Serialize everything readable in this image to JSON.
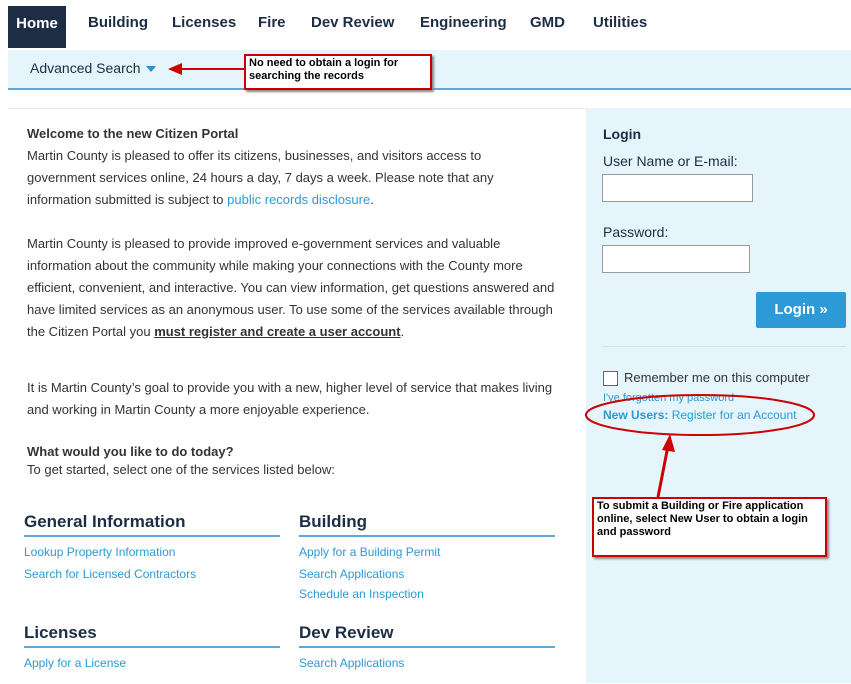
{
  "nav": {
    "tabs": [
      "Home",
      "Building",
      "Licenses",
      "Fire",
      "Dev Review",
      "Engineering",
      "GMD",
      "Utilities"
    ],
    "advanced_search": "Advanced Search"
  },
  "callouts": {
    "top": "No need to obtain a login for searching the records",
    "bottom": "To submit a Building or Fire application online, select New User to obtain a login and password"
  },
  "welcome": {
    "title": "Welcome to the new Citizen Portal",
    "p1_a": "Martin County is pleased to offer its citizens, businesses, and visitors access to government services online, 24 hours a day, 7 days a week.  Please note that any information submitted is subject to ",
    "p1_link": "public records disclosure",
    "p1_end": ".",
    "p2_a": "Martin County is pleased to provide improved e-government services and valuable information about the community while making your connections with the County more efficient, convenient, and interactive. You can view information, get questions answered and have limited services as an anonymous user.  To use some of the services available through the Citizen Portal you ",
    "p2_bold": "must register and create a user account",
    "p2_end": ".",
    "p3": "It is Martin County’s goal to provide you with a new, higher level of service that makes living and working in Martin County a more enjoyable experience.",
    "todo_title": "What would you like to do today?",
    "todo_sub": "To get started, select one of the services listed below:"
  },
  "sections": {
    "general": {
      "title": "General Information",
      "links": [
        "Lookup Property Information",
        "Search for Licensed Contractors"
      ]
    },
    "building": {
      "title": "Building",
      "links": [
        "Apply for a Building Permit",
        "Search Applications",
        "Schedule an Inspection"
      ]
    },
    "licenses": {
      "title": "Licenses",
      "links": [
        "Apply for a License"
      ]
    },
    "devreview": {
      "title": "Dev Review",
      "links": [
        "Search Applications"
      ]
    }
  },
  "login": {
    "title": "Login",
    "user_label": "User Name or E-mail:",
    "user_value": "",
    "pass_label": "Password:",
    "pass_value": "",
    "button": "Login »",
    "remember": "Remember me on this computer",
    "forgot": "I've forgotten my password",
    "new_users_bold": "New Users:",
    "register": "Register for an Account"
  },
  "colors": {
    "navy": "#1c2d44",
    "link_blue": "#2b9ad6",
    "panel_bg": "#e6f4fb",
    "annotation_red": "#cc0000"
  }
}
